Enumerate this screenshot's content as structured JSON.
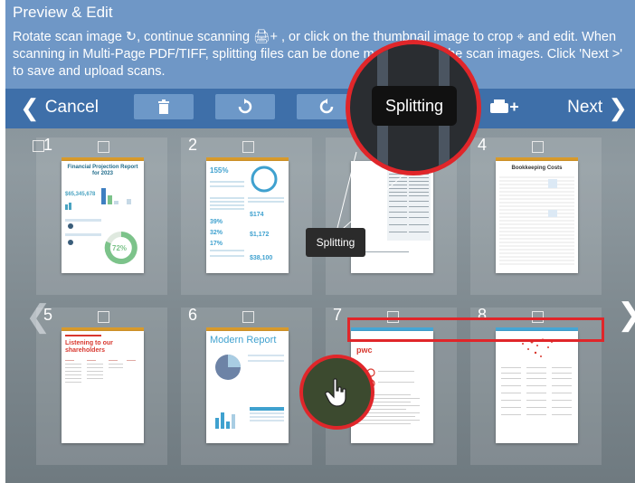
{
  "header": {
    "title": "Preview & Edit",
    "description": "Rotate scan image ↻, continue scanning 🖨+ , or click on the thumbnail image to crop ⌖ and edit.  When scanning in Multi-Page PDF/TIFF, splitting files can be done m… between the scan images.  Click 'Next >' to save and upload scans."
  },
  "toolbar": {
    "cancel_label": "Cancel",
    "next_label": "Next"
  },
  "tooltip": {
    "text": "Splitting"
  },
  "thumbnails": [
    {
      "number": "1",
      "title_line1": "Financial Projection Report for 2023",
      "big_value": "$65,345,678",
      "percent": "72%"
    },
    {
      "number": "2",
      "percent_a": "155%",
      "value_a": "$174",
      "value_b": "$1,172",
      "value_c": "$38,100",
      "pct_b": "39%",
      "pct_c": "32%",
      "pct_d": "17%"
    },
    {
      "number": "3"
    },
    {
      "number": "4",
      "title": "Bookkeeping Costs"
    },
    {
      "number": "5",
      "heading": "Listening to our shareholders"
    },
    {
      "number": "6",
      "title": "Modern Report"
    },
    {
      "number": "7",
      "brand": "pwc"
    },
    {
      "number": "8"
    }
  ]
}
